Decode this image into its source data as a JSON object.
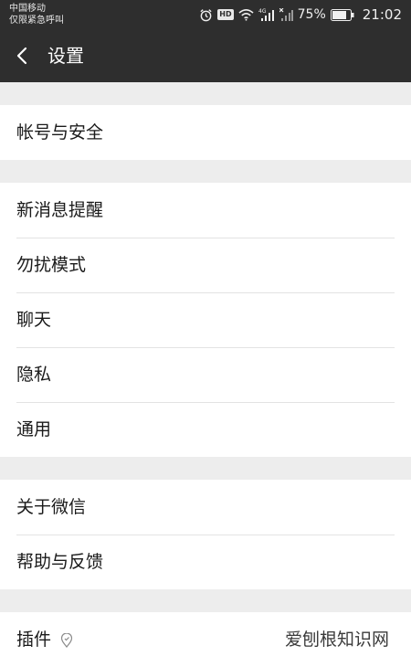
{
  "status_bar": {
    "carrier": "中国移动",
    "emergency": "仅限紧急呼叫",
    "network": "4G",
    "hd_badge": "HD",
    "battery": "75%",
    "time": "21:02"
  },
  "header": {
    "title": "设置",
    "back_icon": "chevron-left-icon"
  },
  "groups": [
    {
      "items": [
        {
          "label": "帐号与安全"
        }
      ]
    },
    {
      "items": [
        {
          "label": "新消息提醒"
        },
        {
          "label": "勿扰模式"
        },
        {
          "label": "聊天"
        },
        {
          "label": "隐私"
        },
        {
          "label": "通用"
        }
      ]
    },
    {
      "items": [
        {
          "label": "关于微信"
        },
        {
          "label": "帮助与反馈"
        }
      ]
    },
    {
      "items": [
        {
          "label": "插件",
          "icon": "location-pin-icon"
        }
      ]
    }
  ],
  "watermark": "爱刨根知识网"
}
